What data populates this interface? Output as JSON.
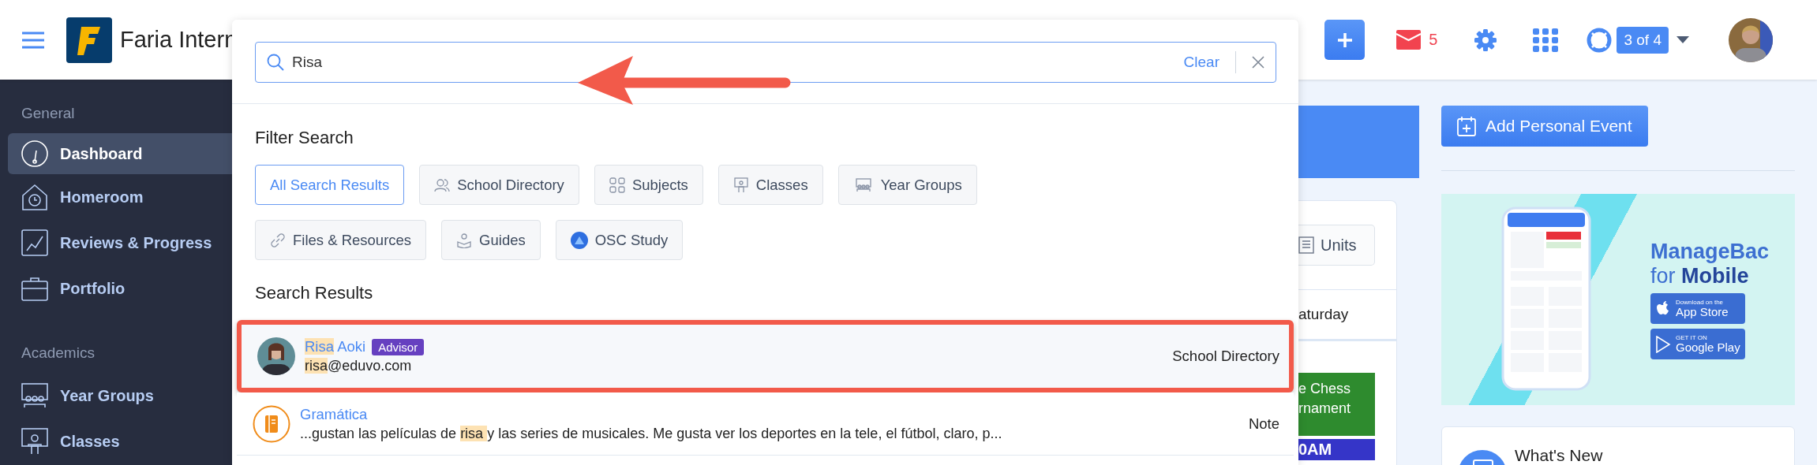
{
  "header": {
    "school_name": "Faria Intern",
    "mail_count": "5",
    "help_progress": "3 of 4"
  },
  "sidebar": {
    "sections": [
      {
        "title": "General",
        "items": [
          {
            "label": "Dashboard",
            "kind": "gauge",
            "selected": true
          },
          {
            "label": "Homeroom",
            "kind": "house",
            "selected": false
          },
          {
            "label": "Reviews & Progress",
            "kind": "chart",
            "selected": false
          },
          {
            "label": "Portfolio",
            "kind": "briefcase",
            "selected": false
          }
        ]
      },
      {
        "title": "Academics",
        "items": [
          {
            "label": "Year Groups",
            "kind": "group",
            "selected": false
          },
          {
            "label": "Classes",
            "kind": "teacher",
            "selected": false
          }
        ]
      }
    ]
  },
  "search": {
    "value": "Risa",
    "clear_label": "Clear",
    "annotation_arrow": true,
    "filter_title": "Filter Search",
    "filters": [
      {
        "label": "All Search Results",
        "kind": "plain",
        "selected": true
      },
      {
        "label": "School Directory",
        "kind": "people",
        "selected": false
      },
      {
        "label": "Subjects",
        "kind": "squares",
        "selected": false
      },
      {
        "label": "Classes",
        "kind": "teacher",
        "selected": false
      },
      {
        "label": "Year Groups",
        "kind": "group",
        "selected": false
      },
      {
        "label": "Files & Resources",
        "kind": "link",
        "selected": false
      },
      {
        "label": "Guides",
        "kind": "reader",
        "selected": false
      },
      {
        "label": "OSC Study",
        "kind": "osc",
        "selected": false
      }
    ],
    "results_title": "Search Results",
    "results": [
      {
        "kind": "person",
        "outlined": true,
        "title": [
          {
            "text": "Risa",
            "highlighted": true
          },
          {
            "text": " Aoki",
            "highlighted": false
          }
        ],
        "badge": "Advisor",
        "detail": [
          {
            "text": "risa",
            "highlighted": true
          },
          {
            "text": "@eduvo.com",
            "highlighted": false
          }
        ],
        "category": "School Directory"
      },
      {
        "kind": "note",
        "outlined": false,
        "title": [
          {
            "text": "Gramática",
            "highlighted": false
          }
        ],
        "detail": [
          {
            "text": "...gustan las películas de ",
            "highlighted": false
          },
          {
            "text": "risa ",
            "highlighted": true
          },
          {
            "text": "y las series de musicales. Me gusta ver los deportes en la tele, el fútbol, claro, p...",
            "highlighted": false
          }
        ],
        "category": "Note"
      }
    ]
  },
  "main": {
    "units_label": "Units",
    "day_label": "aturday",
    "event_title": "e Chess\nrnament",
    "event_time": "0AM"
  },
  "right": {
    "add_event_label": "Add Personal Event",
    "promo": {
      "title": "ManageBac",
      "subtitle_plain": "for",
      "subtitle_bold": "Mobile",
      "app_store_small": "Download on the",
      "app_store_big": "App Store",
      "google_small": "GET IT ON",
      "google_big": "Google Play"
    },
    "whats_new": "What's New"
  }
}
